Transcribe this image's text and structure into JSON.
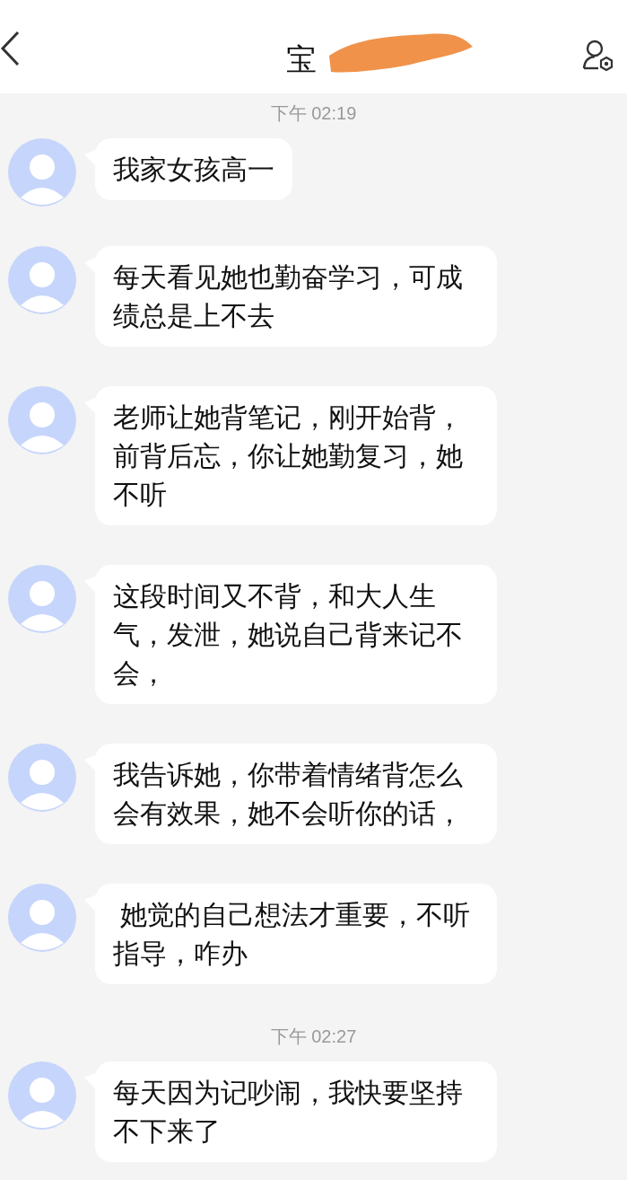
{
  "header": {
    "title": "宝"
  },
  "items": [
    {
      "kind": "time",
      "text": "下午 02:19"
    },
    {
      "kind": "message",
      "text": "我家女孩高一"
    },
    {
      "kind": "message",
      "text": "每天看见她也勤奋学习，可成绩总是上不去"
    },
    {
      "kind": "message",
      "text": "老师让她背笔记，刚开始背，前背后忘，你让她勤复习，她不听"
    },
    {
      "kind": "message",
      "text": "这段时间又不背，和大人生气，发泄，她说自己背来记不会，"
    },
    {
      "kind": "message",
      "text": "我告诉她，你带着情绪背怎么会有效果，她不会听你的话，"
    },
    {
      "kind": "message",
      "text": " 她觉的自己想法才重要，不听指导，咋办"
    },
    {
      "kind": "time",
      "text": "下午 02:27"
    },
    {
      "kind": "message",
      "text": "每天因为记吵闹，我快要坚持不下来了"
    }
  ]
}
